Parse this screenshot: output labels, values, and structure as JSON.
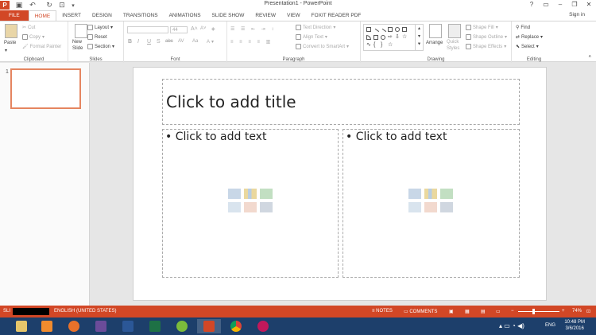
{
  "window": {
    "title": "Presentation1 - PowerPoint",
    "minimize": "–",
    "restore": "❐",
    "close": "✕",
    "help": "?"
  },
  "quick_access": {
    "save_icon": "save-icon",
    "undo_icon": "undo-icon",
    "redo_icon": "redo-icon",
    "start_icon": "start-from-beginning-icon"
  },
  "tabs": [
    "FILE",
    "HOME",
    "INSERT",
    "DESIGN",
    "TRANSITIONS",
    "ANIMATIONS",
    "SLIDE SHOW",
    "REVIEW",
    "VIEW",
    "FOXIT READER PDF"
  ],
  "sign_in": "Sign in",
  "ribbon": {
    "clipboard": {
      "paste": "Paste",
      "cut": "Cut",
      "copy": "Copy",
      "format_painter": "Format Painter",
      "label": "Clipboard"
    },
    "slides": {
      "new_slide": "New\nSlide",
      "layout": "Layout",
      "reset": "Reset",
      "section": "Section",
      "label": "Slides"
    },
    "font": {
      "size": "44",
      "bold": "B",
      "italic": "I",
      "underline": "U",
      "strike": "S",
      "shadow": "abc",
      "spacing": "AV",
      "case": "Aa",
      "color": "A",
      "label": "Font"
    },
    "paragraph": {
      "text_direction": "Text Direction",
      "align_text": "Align Text",
      "convert_smartart": "Convert to SmartArt",
      "label": "Paragraph"
    },
    "drawing": {
      "arrange": "Arrange",
      "quick_styles": "Quick\nStyles",
      "shape_fill": "Shape Fill",
      "shape_outline": "Shape Outline",
      "shape_effects": "Shape Effects",
      "label": "Drawing"
    },
    "editing": {
      "find": "Find",
      "replace": "Replace",
      "select": "Select",
      "label": "Editing"
    }
  },
  "thumbnails": {
    "number": "1"
  },
  "slide": {
    "title_placeholder": "Click to add title",
    "left_placeholder": "• Click to add text",
    "right_placeholder": "• Click to add text"
  },
  "status": {
    "slide": "SLI",
    "language": "ENGLISH (UNITED STATES)",
    "notes": "NOTES",
    "comments": "COMMENTS",
    "zoom": "74%"
  },
  "taskbar": {
    "time": "10:48 PM",
    "date": "3/6/2016",
    "lang": "ENG"
  },
  "colors": {
    "accent": "#d24726",
    "taskbar": "#1d3f6b"
  }
}
